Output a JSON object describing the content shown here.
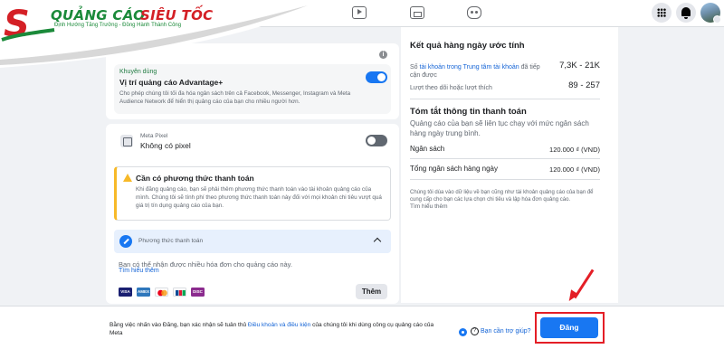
{
  "logo": {
    "word1": "QUẢNG CÁO",
    "word2": "SIÊU TỐC",
    "tagline": "Định Hướng Tăng Trưởng - Đồng Hành Thành Công"
  },
  "topbar": {
    "icons": [
      "video-icon",
      "marketplace-icon",
      "gaming-icon",
      "menu-grid-icon",
      "notifications-icon",
      "profile-avatar"
    ]
  },
  "placements": {
    "recommended_label": "Khuyên dùng",
    "title": "Vị trí quảng cáo Advantage+",
    "description": "Cho phép chúng tôi tối đa hóa ngân sách trên cả Facebook, Messenger, Instagram và Meta Audience Network để hiển thị quảng cáo của bạn cho nhiều người hơn.",
    "enabled": true
  },
  "pixel": {
    "label": "Meta Pixel",
    "value": "Không có pixel",
    "enabled": false
  },
  "payment_warning": {
    "title": "Cần có phương thức thanh toán",
    "description": "Khi đăng quảng cáo, bạn sẽ phải thêm phương thức thanh toán vào tài khoản quảng cáo của mình. Chúng tôi sẽ tính phí theo phương thức thanh toán này đối với mọi khoản chi tiêu vượt quá giá trị tín dụng quảng cáo của bạn."
  },
  "payment_method": {
    "section_title": "Phương thức thanh toán",
    "description": "Bạn có thể nhận được nhiều hóa đơn cho quảng cáo này.",
    "learn_more": "Tìm hiểu thêm",
    "cards": [
      "VISA",
      "AMEX",
      "MC",
      "JCB",
      "DISC"
    ],
    "add_button": "Thêm"
  },
  "estimates": {
    "title": "Kết quả hàng ngày ước tính",
    "reach_prefix": "Số",
    "reach_link": "tài khoản trong Trung tâm tài khoản",
    "reach_suffix": "đã tiếp cận được",
    "reach_value": "7,3K - 21K",
    "likes_label": "Lượt theo dõi hoặc lượt thích",
    "likes_value": "89 - 257"
  },
  "payment_summary": {
    "title": "Tóm tắt thông tin thanh toán",
    "description": "Quảng cáo của bạn sẽ liên tục chạy với mức ngân sách hàng ngày trung bình.",
    "budget_label": "Ngân sách",
    "budget_value": "120.000 ₫ (VND)",
    "total_label": "Tổng ngân sách hàng ngày",
    "total_value": "120.000 ₫ (VND)",
    "note": "Chúng tôi dùa vào dữ liệu về bạn cũng như tài khoản quảng cáo của bạn để cung cấp cho bạn các lựa chọn chi tiêu và lập hóa đơn quảng cáo.",
    "learn_more": "Tìm hiểu thêm"
  },
  "footer": {
    "terms_prefix": "Bằng việc nhấn vào Đăng, bạn xác nhận sẽ tuân thủ",
    "terms_link": "Điều khoản và điều kiện",
    "terms_suffix": "của chúng tôi khi dùng công cụ quảng cáo của Meta",
    "help_label": "Bạn cần trợ giúp?",
    "publish_button": "Đăng"
  },
  "colors": {
    "accent": "#1877f2",
    "highlight": "#e41e26",
    "logo_green": "#1b8a3a",
    "logo_red": "#d42026",
    "warning": "#f7b928"
  }
}
